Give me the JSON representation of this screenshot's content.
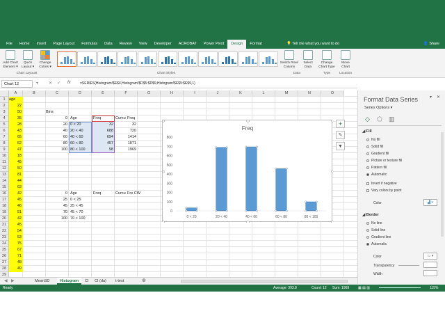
{
  "ribbon_tabs": [
    "File",
    "Home",
    "Insert",
    "Page Layout",
    "Formulas",
    "Data",
    "Review",
    "View",
    "Developer",
    "ACROBAT",
    "Power Pivot",
    "Design",
    "Format"
  ],
  "active_tab": "Design",
  "tell_me": "Tell me what you want to do",
  "share": "Share",
  "ribbon": {
    "add_chart_element": "Add Chart Element ▾",
    "quick_layout": "Quick Layout ▾",
    "change_colors": "Change Colors ▾",
    "chart_layouts_group": "Chart Layouts",
    "chart_styles_group": "Chart Styles",
    "switch_row_column": "Switch Row/ Column",
    "select_data": "Select Data",
    "data_group": "Data",
    "change_chart_type": "Change Chart Type",
    "type_group": "Type",
    "move_chart": "Move Chart",
    "location_group": "Location"
  },
  "name_box": "Chart 12",
  "formula": "=SERIES(Histogram!$E$4,Histogram!$D$5:$D$9,Histogram!$E$5:$E$9,1)",
  "fx": "fx",
  "columns": [
    "A",
    "B",
    "C",
    "D",
    "E",
    "F",
    "G",
    "H",
    "I",
    "J",
    "K",
    "L",
    "M",
    "N",
    "O"
  ],
  "rows": [
    "1",
    "2",
    "3",
    "4",
    "5",
    "6",
    "7",
    "8",
    "9",
    "10",
    "11",
    "12",
    "13",
    "14",
    "15",
    "16",
    "17",
    "18",
    "19",
    "20",
    "21",
    "22",
    "23",
    "24",
    "25",
    "26",
    "27",
    "28",
    "29"
  ],
  "col_a": [
    "age",
    "22",
    "50",
    "35",
    "28",
    "43",
    "65",
    "52",
    "47",
    "18",
    "45",
    "50",
    "81",
    "44",
    "63",
    "42",
    "45",
    "46",
    "51",
    "42",
    "45",
    "54",
    "53",
    "75",
    "67",
    "71",
    "48",
    "49"
  ],
  "sheet_cells": {
    "c3": "Bins",
    "bins_top": [
      "0",
      "20",
      "40",
      "60",
      "80",
      "100"
    ],
    "ranges_top": [
      "Age",
      "0 < 20",
      "20 < 40",
      "40 < 60",
      "60 < 80",
      "80 < 100"
    ],
    "freq_top": [
      "Freq",
      "32",
      "688",
      "694",
      "457",
      "98"
    ],
    "cumu_header": "Cumu",
    "freq2_header": "Freq",
    "cumu_top": [
      "32",
      "720",
      "1414",
      "1871",
      "1969"
    ],
    "bins_bottom": [
      "0",
      "25",
      "45",
      "70",
      "100"
    ],
    "ranges_bottom": [
      "Age",
      "0 < 25",
      "25 < 45",
      "45 < 70",
      "70 < 100"
    ],
    "freq_bottom": "Freq",
    "cumu_bottom": "Cumu",
    "fre_cw": "Fre CW"
  },
  "chart_data": {
    "type": "bar",
    "title": "Freq",
    "categories": [
      "0 < 20",
      "20 < 40",
      "40 < 60",
      "60 < 80",
      "80 < 100"
    ],
    "values": [
      32,
      688,
      694,
      457,
      98
    ],
    "yticks": [
      "0",
      "100",
      "200",
      "300",
      "400",
      "500",
      "600",
      "700",
      "800"
    ],
    "ylim": [
      0,
      800
    ],
    "grid": false,
    "bar_color": "#5b9bd5"
  },
  "pane": {
    "title": "Format Data Series",
    "series_options": "Series Options",
    "fill_section": "Fill",
    "fill_options": [
      "No fill",
      "Solid fill",
      "Gradient fill",
      "Picture or texture fill",
      "Pattern fill",
      "Automatic"
    ],
    "fill_selected": 5,
    "invert": "Invert if negative",
    "vary": "Vary colors by point",
    "color_label": "Color",
    "border_section": "Border",
    "border_options": [
      "No line",
      "Solid line",
      "Gradient line",
      "Automatic"
    ],
    "border_selected": 3,
    "border_color_label": "Color",
    "transparency_label": "Transparency",
    "width_label": "Width"
  },
  "sheet_tabs": [
    "MeanSD",
    "Histogram",
    "CI",
    "CI (da)",
    "t-test"
  ],
  "active_sheet": "Histogram",
  "status": {
    "ready": "Ready",
    "average": "Average: 393.8",
    "count": "Count: 12",
    "sum": "Sum: 1969",
    "zoom": "115%"
  }
}
